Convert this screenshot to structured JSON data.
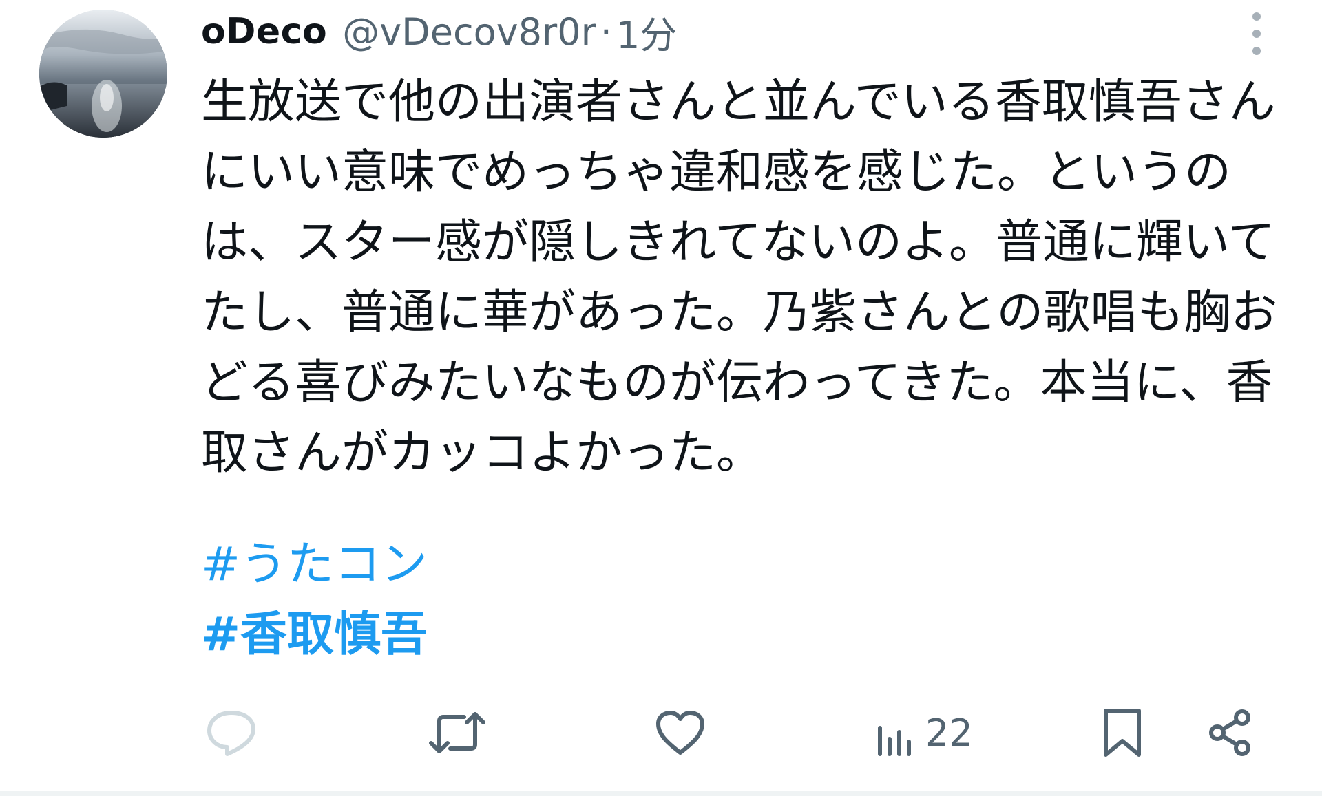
{
  "tweet": {
    "author": {
      "display_name": "oDeco",
      "handle": "@vDecov8r0r",
      "separator": "·",
      "time": "1分"
    },
    "text": "生放送で他の出演者さんと並んでいる香取慎吾さんにいい意味でめっちゃ違和感を感じた。というのは、スター感が隠しきれてないのよ。普通に輝いてたし、普通に華があった。乃紫さんとの歌唱も胸おどる喜びみたいなものが伝わってきた。本当に、香取さんがカッコよかった。",
    "hashtags": [
      "#うたコン",
      "#香取慎吾"
    ]
  },
  "actions": {
    "views_count": "22"
  },
  "icons": {
    "reply": "reply-icon",
    "retweet": "retweet-icon",
    "like": "heart-icon",
    "views": "views-icon",
    "bookmark": "bookmark-icon",
    "share": "share-icon",
    "more": "more-vertical-icon"
  },
  "colors": {
    "text": "#0f1419",
    "secondary": "#536471",
    "link": "#1d9bf0",
    "reply_icon": "#cfd9de"
  }
}
